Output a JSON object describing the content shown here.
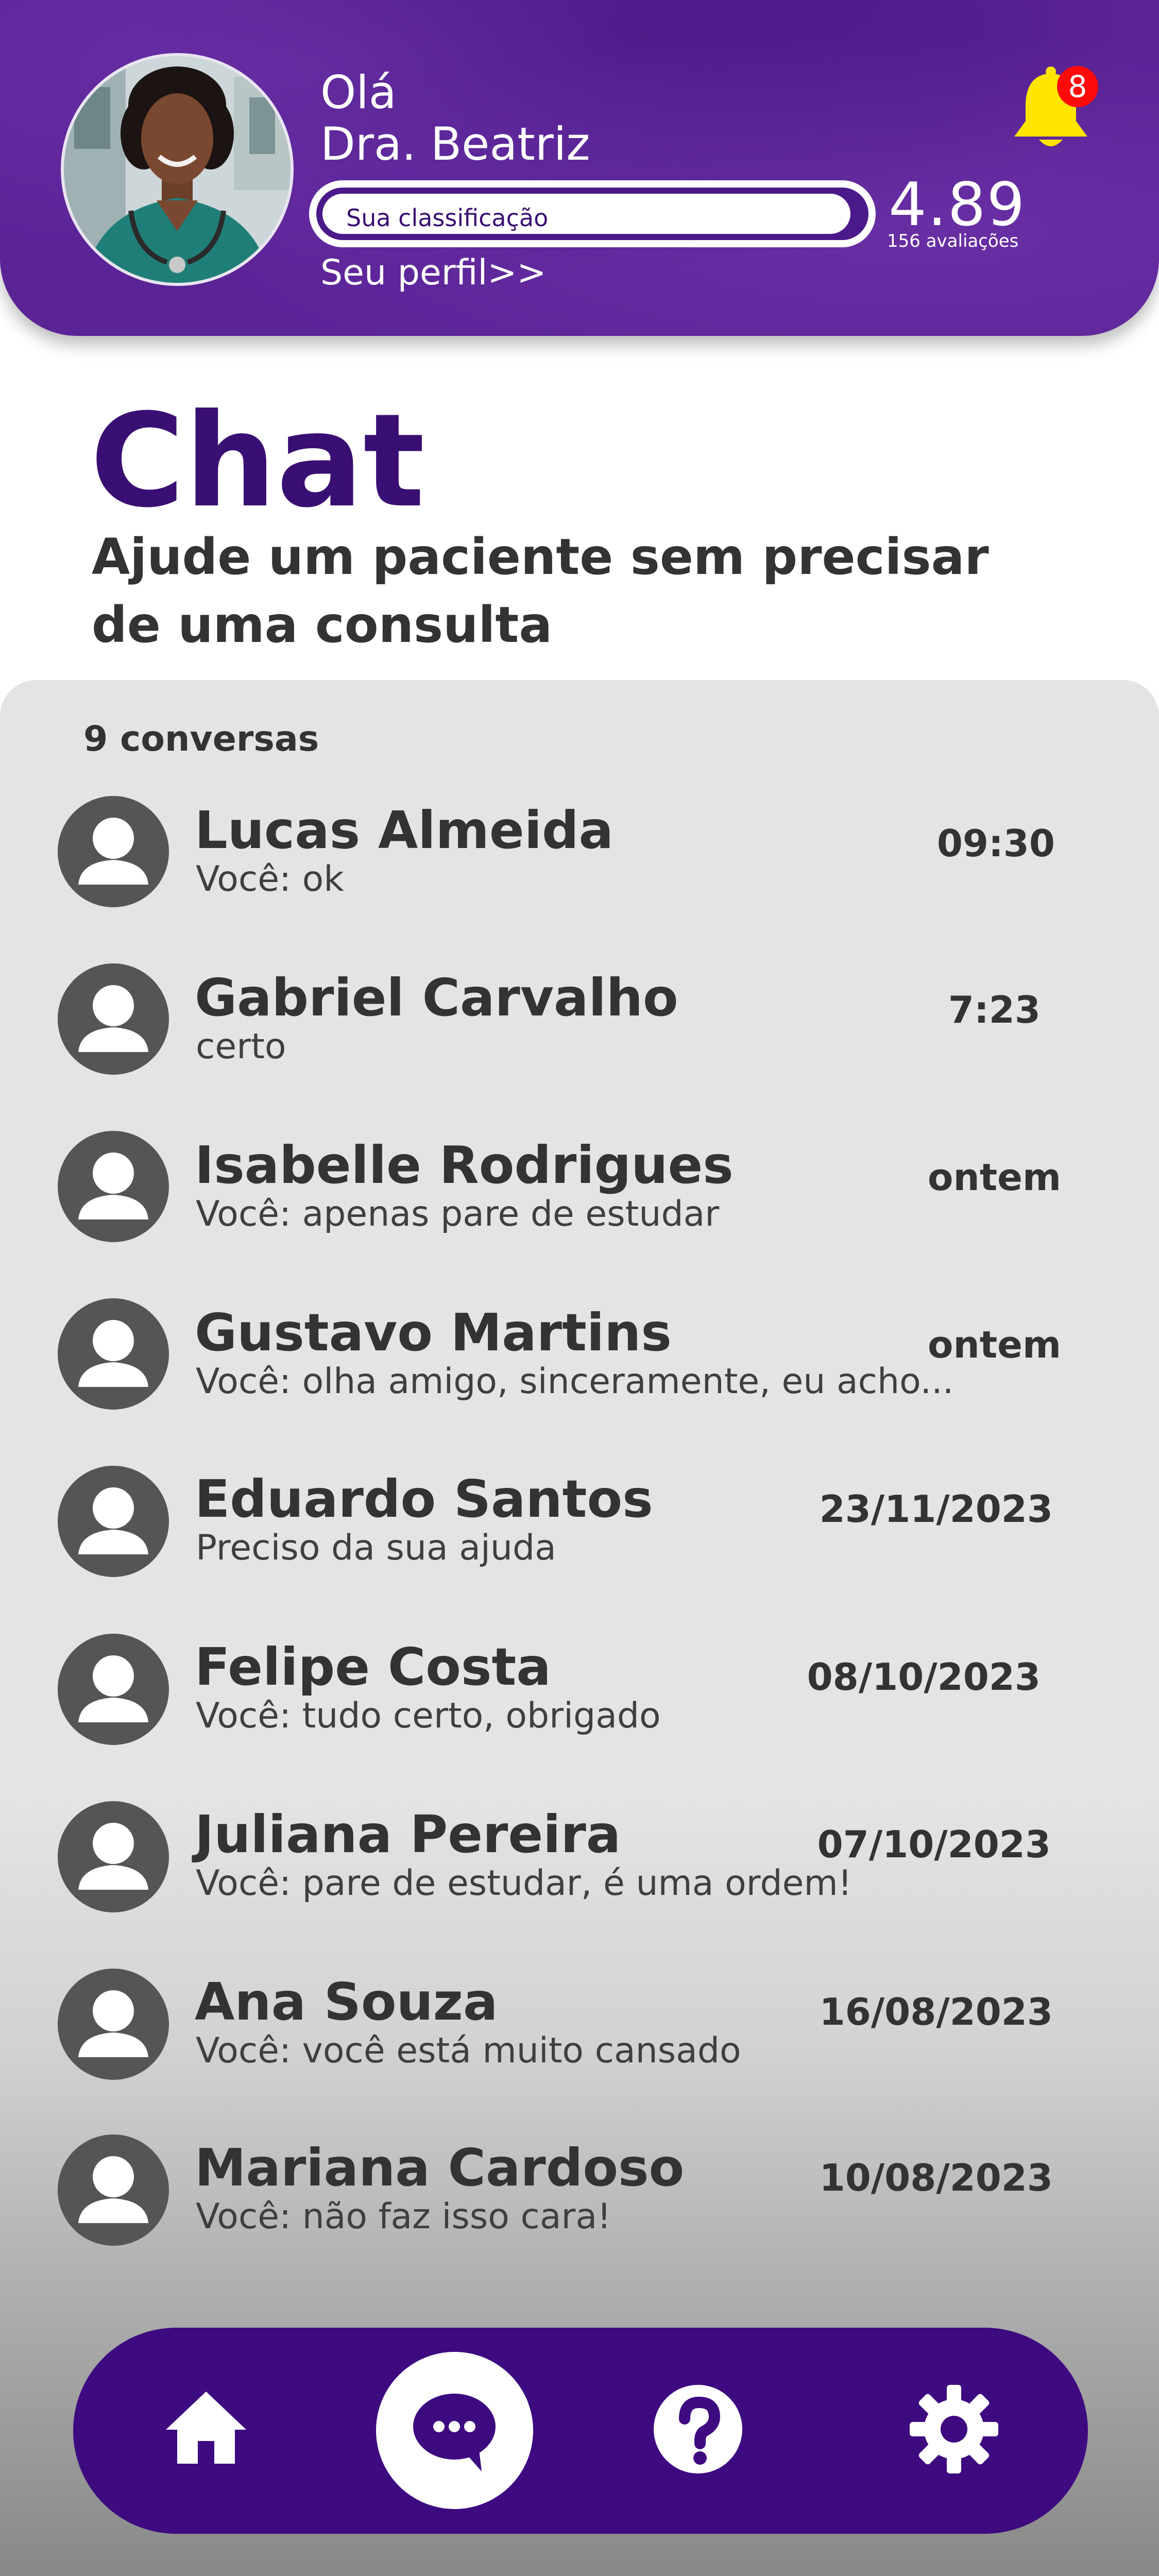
{
  "header": {
    "greeting": "Olá",
    "doctor_name": "Dra. Beatriz",
    "rating_label": "Sua classificação",
    "rating_value": "4.89",
    "rating_count": "156 avaliações",
    "rating_fill_fraction": 0.978,
    "profile_link": "Seu perfil>>",
    "notification_count": "8",
    "icons": {
      "bell": "bell-icon",
      "avatar": "doctor-avatar"
    }
  },
  "page": {
    "title": "Chat",
    "subtitle": "Ajude um paciente sem precisar de uma consulta"
  },
  "conversations": {
    "count_label": "9 conversas",
    "items": [
      {
        "name": "Lucas Almeida",
        "message": "Você: ok",
        "time": "09:30"
      },
      {
        "name": "Gabriel Carvalho",
        "message": "certo",
        "time": "7:23"
      },
      {
        "name": "Isabelle Rodrigues",
        "message": "Você: apenas pare de estudar",
        "time": "ontem"
      },
      {
        "name": "Gustavo Martins",
        "message": "Você: olha amigo, sinceramente, eu acho...",
        "time": "ontem"
      },
      {
        "name": "Eduardo Santos",
        "message": "Preciso da sua ajuda",
        "time": "23/11/2023"
      },
      {
        "name": "Felipe Costa",
        "message": "Você: tudo certo, obrigado",
        "time": "08/10/2023"
      },
      {
        "name": "Juliana Pereira",
        "message": "Você: pare de estudar, é uma ordem!",
        "time": "07/10/2023"
      },
      {
        "name": "Ana Souza",
        "message": "Você: você está muito cansado",
        "time": "16/08/2023"
      },
      {
        "name": "Mariana Cardoso",
        "message": "Você: não faz isso cara!",
        "time": "10/08/2023"
      }
    ]
  },
  "nav": {
    "items": [
      "home-icon",
      "chat-icon",
      "help-icon",
      "settings-icon"
    ],
    "active": "chat-icon"
  },
  "colors": {
    "primary": "#3d0a80",
    "header": "#5a2396",
    "accent_bell": "#ffe500",
    "badge": "#ff0a0a",
    "panel": "#e4e4e4"
  }
}
